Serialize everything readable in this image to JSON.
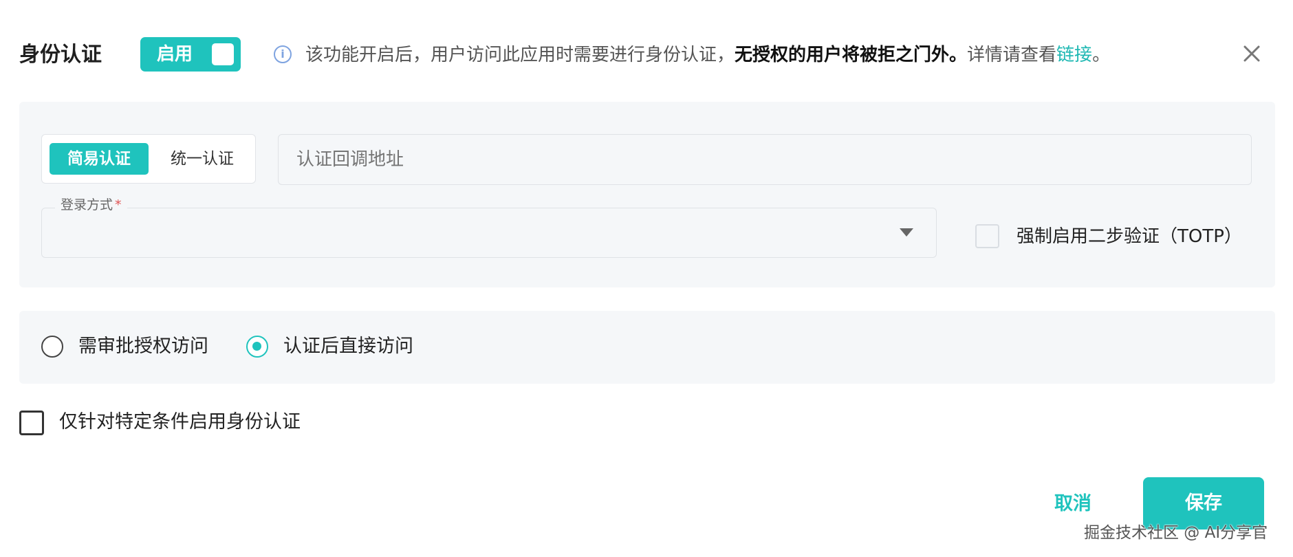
{
  "header": {
    "title": "身份认证",
    "toggle_label": "启用",
    "notice_text": "该功能开启后，用户访问此应用时需要进行身份认证，",
    "notice_bold": "无授权的用户将被拒之门外。",
    "notice_tail": "详情请查看",
    "notice_link": "链接",
    "notice_end": "。"
  },
  "auth_settings": {
    "mode_tabs": [
      "简易认证",
      "统一认证"
    ],
    "active_mode": "简易认证",
    "callback_placeholder": "认证回调地址",
    "login_method_label": "登录方式",
    "login_method_required": "*",
    "totp_label": "强制启用二步验证（TOTP）",
    "totp_checked": false
  },
  "access": {
    "options": [
      "需审批授权访问",
      "认证后直接访问"
    ],
    "selected": "认证后直接访问"
  },
  "condition": {
    "label": "仅针对特定条件启用身份认证",
    "checked": false
  },
  "footer": {
    "cancel_label": "取消",
    "save_label": "保存"
  },
  "watermark": "掘金技术社区 @ AI分享官",
  "colors": {
    "accent": "#1fc3bd",
    "panel_bg": "#f5f7f9",
    "info_icon": "#7ea3e0"
  }
}
